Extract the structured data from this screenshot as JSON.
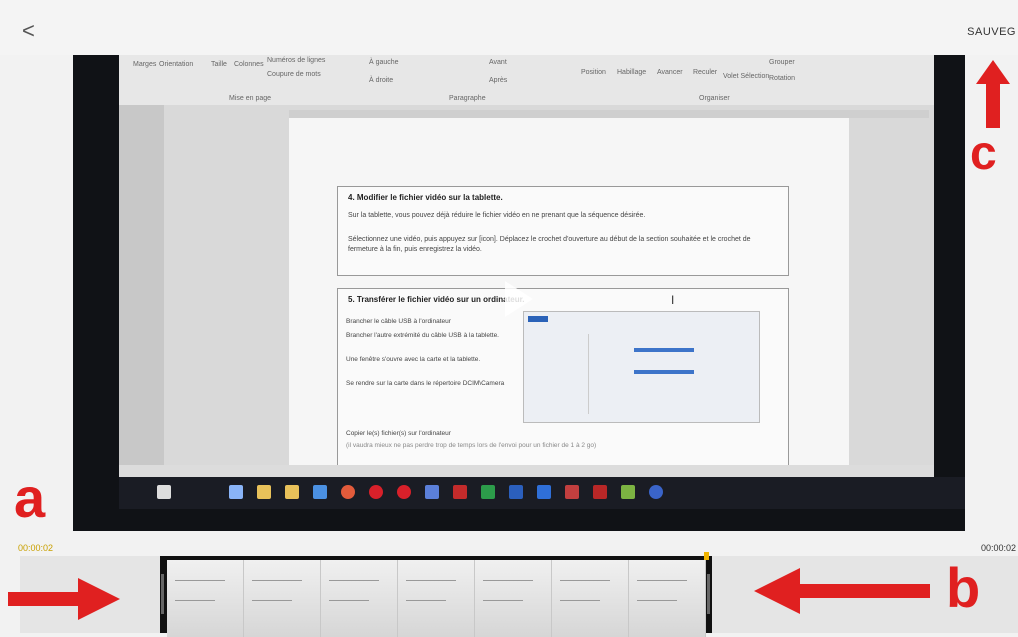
{
  "header": {
    "back_label": "<",
    "save_label": "SAUVEG"
  },
  "document": {
    "ribbon_items": [
      "Marges",
      "Orientation",
      "Taille",
      "Colonnes",
      "Numéros de lignes",
      "Coupure de mots",
      "À gauche",
      "À droite",
      "Avant",
      "Après",
      "Position",
      "Habillage",
      "Avancer",
      "Reculer",
      "Volet Sélection",
      "Grouper",
      "Rotation"
    ],
    "ribbon_groups": [
      "Mise en page",
      "Paragraphe",
      "Organiser"
    ],
    "section4_heading": "4.  Modifier le fichier vidéo sur la tablette.",
    "section4_para1": "Sur la tablette, vous pouvez déjà réduire le fichier vidéo en ne prenant que la séquence désirée.",
    "section4_para2": "Sélectionnez une vidéo, puis appuyez sur [icon]. Déplacez le crochet d'ouverture au début de la section souhaitée et le crochet de fermeture à la fin, puis enregistrez la vidéo.",
    "section5_heading": "5.  Transférer le fichier vidéo sur un ordinateur.",
    "bullets": [
      "Brancher le câble USB à l'ordinateur",
      "Brancher l'autre extrémité du câble USB à la tablette.",
      "Une fenêtre s'ouvre avec la carte et la tablette.",
      "Se rendre sur la carte dans le répertoire DCIM\\Camera",
      "Copier le(s) fichier(s) sur l'ordinateur"
    ],
    "footnote": "(il vaudra mieux ne pas perdre trop de temps lors de l'envoi pour un fichier de 1 à 2 go)"
  },
  "annotations": {
    "a": "a",
    "b": "b",
    "c": "c",
    "color": "#e02020"
  },
  "timeline": {
    "current_time": "00:00:02",
    "end_time": "00:00:02"
  },
  "icons": [
    "back-chevron-icon",
    "play-icon",
    "text-cursor-icon"
  ],
  "colors": {
    "accent_time": "#c9a000",
    "annotation_red": "#e02020",
    "playhead": "#f0b400"
  }
}
